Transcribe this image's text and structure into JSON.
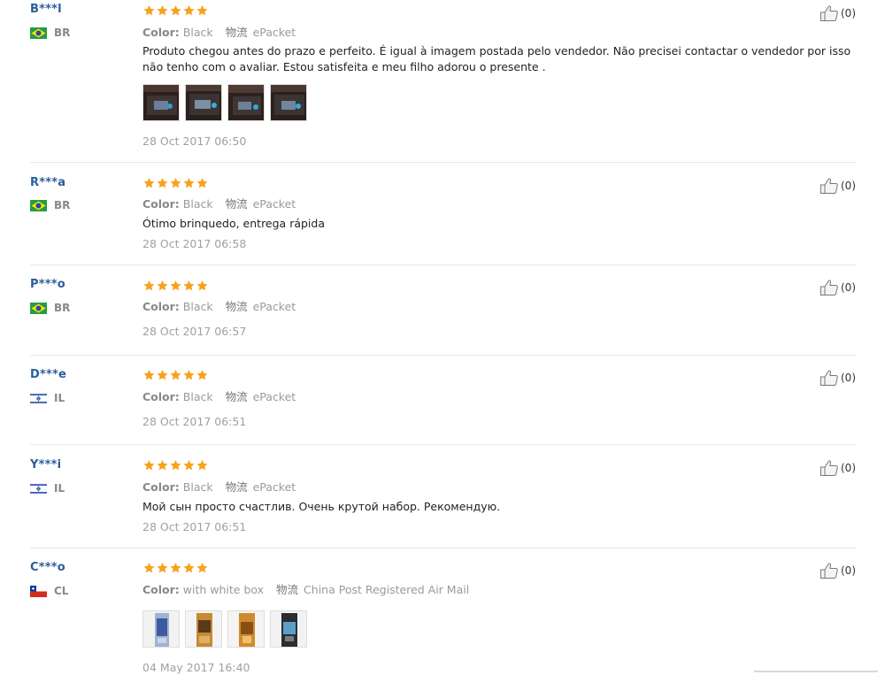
{
  "reviews": [
    {
      "user": "B***l",
      "country": "BR",
      "color_label": "Color:",
      "color": "Black",
      "ship_label": "物流",
      "ship": "ePacket",
      "text": "Produto chegou antes do prazo e perfeito. É igual à imagem postada pelo vendedor. Não precisei contactar o vendedor por isso não tenho com o avaliar. Estou satisfeita e meu filho adorou o presente .",
      "date": "28 Oct 2017 06:50",
      "likes": "(0)",
      "stars": 5,
      "photo_count": 4
    },
    {
      "user": "R***a",
      "country": "BR",
      "color_label": "Color:",
      "color": "Black",
      "ship_label": "物流",
      "ship": "ePacket",
      "text": "Ótimo brinquedo, entrega rápida",
      "date": "28 Oct 2017 06:58",
      "likes": "(0)",
      "stars": 5
    },
    {
      "user": "P***o",
      "country": "BR",
      "color_label": "Color:",
      "color": "Black",
      "ship_label": "物流",
      "ship": "ePacket",
      "text": "",
      "date": "28 Oct 2017 06:57",
      "likes": "(0)",
      "stars": 5
    },
    {
      "user": "D***e",
      "country": "IL",
      "color_label": "Color:",
      "color": "Black",
      "ship_label": "物流",
      "ship": "ePacket",
      "text": "",
      "date": "28 Oct 2017 06:51",
      "likes": "(0)",
      "stars": 5
    },
    {
      "user": "Y***i",
      "country": "IL",
      "color_label": "Color:",
      "color": "Black",
      "ship_label": "物流",
      "ship": "ePacket",
      "text": "Мой сын просто счастлив. Очень крутой набор. Рекомендую.",
      "date": "28 Oct 2017 06:51",
      "likes": "(0)",
      "stars": 5
    },
    {
      "user": "C***o",
      "country": "CL",
      "color_label": "Color:",
      "color": "with white box",
      "ship_label": "物流",
      "ship": "China Post Registered Air Mail",
      "text": "",
      "date": "04 May 2017 16:40",
      "likes": "(0)",
      "stars": 5,
      "photo_count": 4
    }
  ],
  "colors": {
    "username": "#2a5d9a",
    "star": "#f7a21b",
    "divider": "#e8e8e8"
  },
  "icons": {
    "like": "thumbs-up-icon",
    "star": "star-icon"
  }
}
